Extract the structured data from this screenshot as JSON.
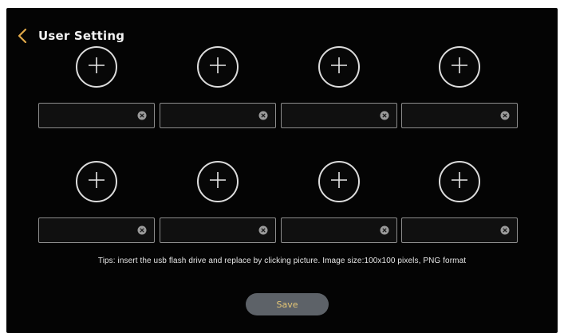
{
  "header": {
    "title": "User Setting",
    "back_icon": "chevron-left-icon",
    "back_color": "#e0a94a"
  },
  "users": [
    {
      "avatar_icon": "plus-icon",
      "name_value": "",
      "clear_icon": "clear-icon"
    },
    {
      "avatar_icon": "plus-icon",
      "name_value": "",
      "clear_icon": "clear-icon"
    },
    {
      "avatar_icon": "plus-icon",
      "name_value": "",
      "clear_icon": "clear-icon"
    },
    {
      "avatar_icon": "plus-icon",
      "name_value": "",
      "clear_icon": "clear-icon"
    },
    {
      "avatar_icon": "plus-icon",
      "name_value": "",
      "clear_icon": "clear-icon"
    },
    {
      "avatar_icon": "plus-icon",
      "name_value": "",
      "clear_icon": "clear-icon"
    },
    {
      "avatar_icon": "plus-icon",
      "name_value": "",
      "clear_icon": "clear-icon"
    },
    {
      "avatar_icon": "plus-icon",
      "name_value": "",
      "clear_icon": "clear-icon"
    }
  ],
  "tips": "Tips: insert the usb flash drive and replace by clicking picture. Image size:100x100 pixels, PNG format",
  "save": {
    "label": "Save",
    "text_color": "#e4c676",
    "bg_color": "#5d6268"
  }
}
